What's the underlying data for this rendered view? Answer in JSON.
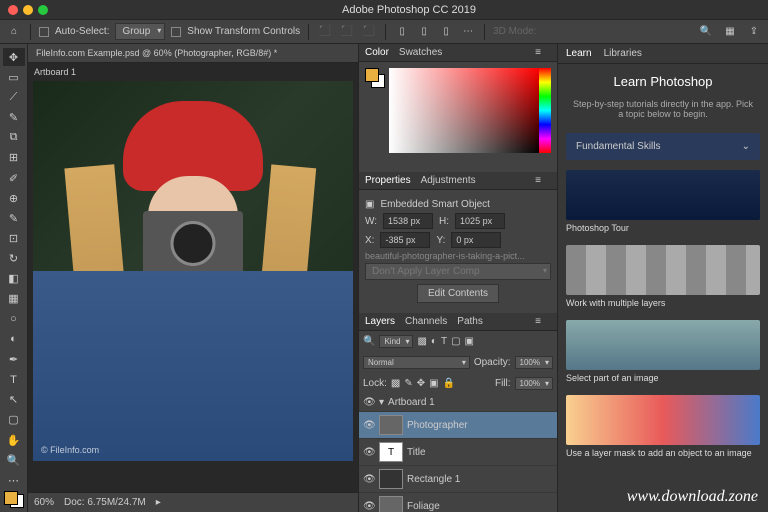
{
  "app": {
    "title": "Adobe Photoshop CC 2019"
  },
  "optbar": {
    "auto_select": "Auto-Select:",
    "group": "Group",
    "transform": "Show Transform Controls",
    "mode3d": "3D Mode:"
  },
  "document": {
    "tab": "FileInfo.com Example.psd @ 60% (Photographer, RGB/8#) *",
    "artboard": "Artboard 1",
    "watermark": "© FileInfo.com"
  },
  "status": {
    "zoom": "60%",
    "doc": "Doc: 6.75M/24.7M"
  },
  "color": {
    "tab1": "Color",
    "tab2": "Swatches"
  },
  "properties": {
    "tab1": "Properties",
    "tab2": "Adjustments",
    "type": "Embedded Smart Object",
    "w_lbl": "W:",
    "w": "1538 px",
    "h_lbl": "H:",
    "h": "1025 px",
    "x_lbl": "X:",
    "x": "-385 px",
    "y_lbl": "Y:",
    "y": "0 px",
    "filename": "beautiful-photographer-is-taking-a-pict...",
    "layer_comp": "Don't Apply Layer Comp",
    "edit": "Edit Contents"
  },
  "layers": {
    "tab1": "Layers",
    "tab2": "Channels",
    "tab3": "Paths",
    "kind": "Kind",
    "blend": "Normal",
    "opacity_lbl": "Opacity:",
    "opacity": "100%",
    "lock_lbl": "Lock:",
    "fill_lbl": "Fill:",
    "fill": "100%",
    "items": [
      {
        "name": "Artboard 1",
        "type": "group"
      },
      {
        "name": "Photographer",
        "type": "smart"
      },
      {
        "name": "Title",
        "type": "text"
      },
      {
        "name": "Rectangle 1",
        "type": "shape"
      },
      {
        "name": "Foliage",
        "type": "smart"
      }
    ]
  },
  "learn": {
    "tab1": "Learn",
    "tab2": "Libraries",
    "title": "Learn Photoshop",
    "subtitle": "Step-by-step tutorials directly in the app. Pick a topic below to begin.",
    "section": "Fundamental Skills",
    "tutorials": [
      "Photoshop Tour",
      "Work with multiple layers",
      "Select part of an image",
      "Use a layer mask to add an object to an image"
    ]
  },
  "watermark_site": "www.download.zone"
}
